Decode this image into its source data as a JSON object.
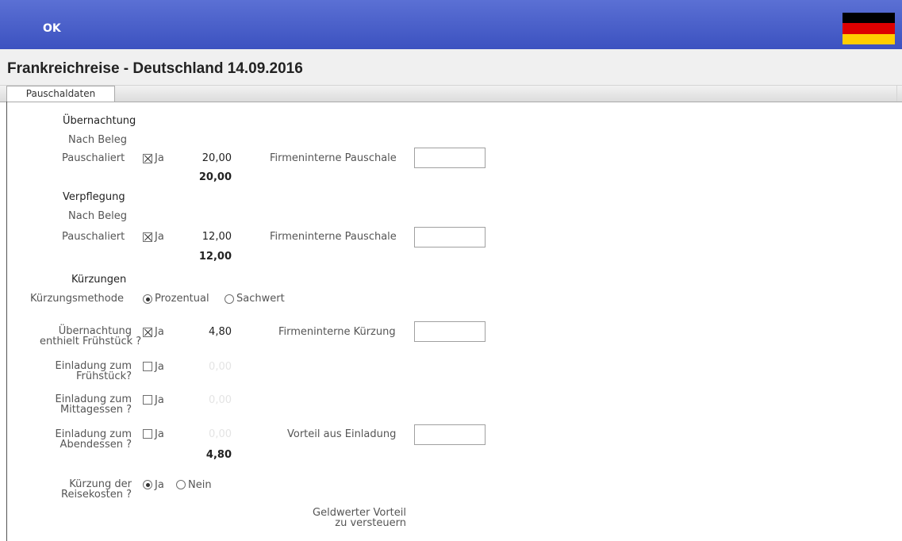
{
  "header": {
    "ok_label": "OK",
    "flag_colors": [
      "#000000",
      "#dd0000",
      "#ffce00"
    ],
    "flag_icon": "germany-flag-icon"
  },
  "title": "Frankreichreise - Deutschland 14.09.2016",
  "tabs": [
    {
      "label": "Pauschaldaten"
    }
  ],
  "uebernachtung": {
    "heading": "Übernachtung",
    "nach_beleg_label": "Nach Beleg",
    "pauschaliert_label": "Pauschaliert",
    "checkbox_label": "Ja",
    "checked": true,
    "amount": "20,00",
    "firmenintern_label": "Firmeninterne Pauschale",
    "firmenintern_value": "",
    "total": "20,00"
  },
  "verpflegung": {
    "heading": "Verpflegung",
    "nach_beleg_label": "Nach Beleg",
    "pauschaliert_label": "Pauschaliert",
    "checkbox_label": "Ja",
    "checked": true,
    "amount": "12,00",
    "firmenintern_label": "Firmeninterne Pauschale",
    "firmenintern_value": "",
    "total": "12,00"
  },
  "kuerzungen": {
    "heading": "Kürzungen",
    "methode_label": "Kürzungsmethode",
    "methode_options": [
      {
        "label": "Prozentual",
        "selected": true
      },
      {
        "label": "Sachwert",
        "selected": false
      }
    ],
    "rows": [
      {
        "label_line1": "Übernachtung",
        "label_line2": "enthielt Frühstück ?",
        "checkbox_label": "Ja",
        "checked": true,
        "amount": "4,80",
        "side_label": "Firmeninterne Kürzung",
        "side_value": ""
      },
      {
        "label_line1": "Einladung zum",
        "label_line2": "Frühstück?",
        "checkbox_label": "Ja",
        "checked": false,
        "amount": "0,00"
      },
      {
        "label_line1": "Einladung zum",
        "label_line2": "Mittagessen ?",
        "checkbox_label": "Ja",
        "checked": false,
        "amount": "0,00"
      },
      {
        "label_line1": "Einladung zum",
        "label_line2": "Abendessen ?",
        "checkbox_label": "Ja",
        "checked": false,
        "amount": "0,00",
        "side_label": "Vorteil aus Einladung",
        "side_value": ""
      }
    ],
    "total": "4,80",
    "reisekosten_label_line1": "Kürzung der",
    "reisekosten_label_line2": "Reisekosten ?",
    "reisekosten_options": [
      {
        "label": "Ja",
        "selected": true
      },
      {
        "label": "Nein",
        "selected": false
      }
    ],
    "geldwert_line1": "Geldwerter Vorteil",
    "geldwert_line2": "zu versteuern"
  }
}
